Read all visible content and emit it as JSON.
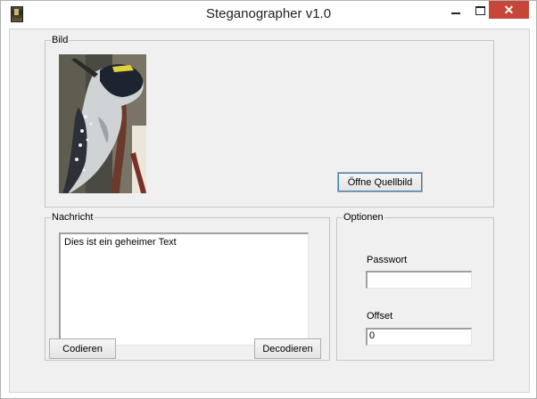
{
  "window": {
    "title": "Steganographer v1.0",
    "close_glyph": "✕"
  },
  "groups": {
    "bild": {
      "label": "Bild"
    },
    "nachricht": {
      "label": "Nachricht"
    },
    "optionen": {
      "label": "Optionen"
    }
  },
  "buttons": {
    "open_source": "Öffne Quellbild",
    "encode": "Codieren",
    "decode": "Decodieren"
  },
  "message": {
    "text": "Dies ist ein geheimer Text"
  },
  "options": {
    "password_label": "Passwort",
    "password_value": "",
    "offset_label": "Offset",
    "offset_value": "0"
  },
  "icons": {
    "app": "woodpecker-app-icon",
    "minimize": "minimize-icon",
    "maximize": "maximize-icon",
    "close": "close-icon"
  },
  "colors": {
    "close_button": "#c7463a",
    "window_bg": "#f0f0f0",
    "focus_outline": "#3c7fb1"
  }
}
